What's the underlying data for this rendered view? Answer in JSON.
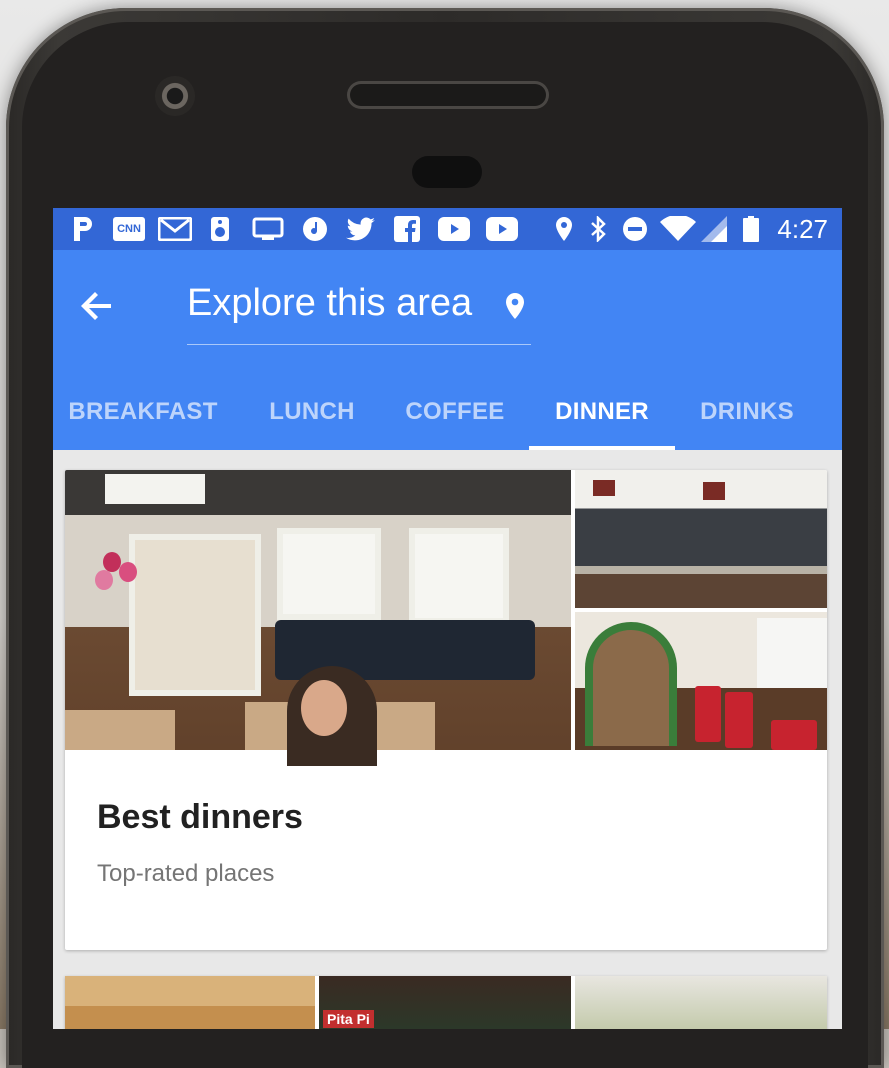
{
  "status_bar": {
    "time": "4:27",
    "left_icons": [
      "pandora-icon",
      "cnn-icon",
      "gmail-icon",
      "speaker-icon",
      "cast-icon",
      "music-icon",
      "twitter-icon",
      "facebook-icon",
      "youtube-icon",
      "youtube-icon"
    ],
    "cnn_text": "CNN",
    "right_icons": [
      "location-icon",
      "bluetooth-icon",
      "do-not-disturb-icon",
      "wifi-icon",
      "signal-icon",
      "battery-icon"
    ]
  },
  "app_bar": {
    "title": "Explore this area",
    "back_icon": "arrow-back-icon",
    "pin_icon": "location-pin-icon",
    "color": "#4285f4",
    "status_color": "#3367d6"
  },
  "tabs": [
    {
      "label": "BREAKFAST",
      "active": false
    },
    {
      "label": "LUNCH",
      "active": false
    },
    {
      "label": "COFFEE",
      "active": false
    },
    {
      "label": "DINNER",
      "active": true
    },
    {
      "label": "DRINKS",
      "active": false
    }
  ],
  "card": {
    "title": "Best dinners",
    "subtitle": "Top-rated places"
  },
  "bottom_card_text": "Pita Pi"
}
